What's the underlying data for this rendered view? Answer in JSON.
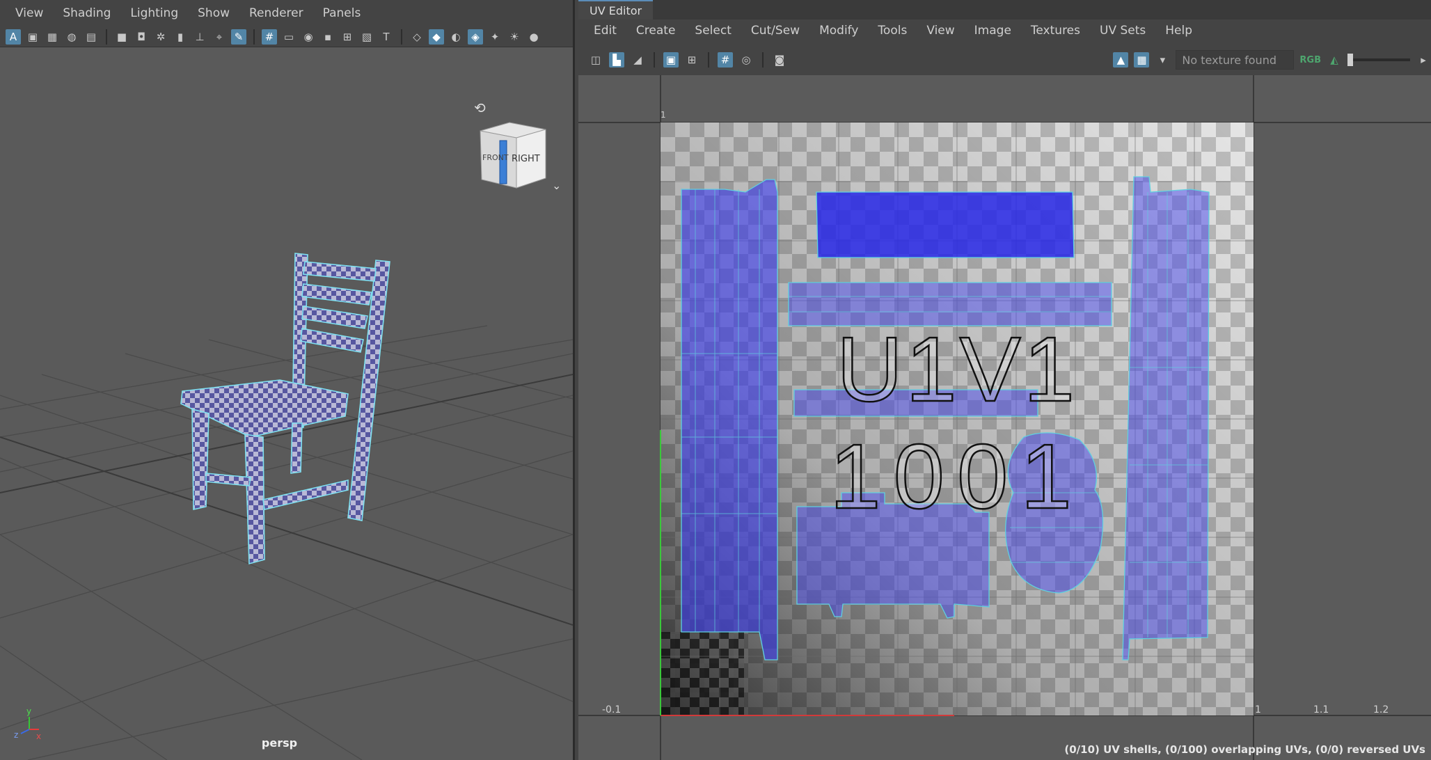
{
  "viewport": {
    "menu": [
      "View",
      "Shading",
      "Lighting",
      "Show",
      "Renderer",
      "Panels"
    ],
    "camera_label": "persp",
    "view_cube": {
      "front_label": "FRONT",
      "right_label": "RIGHT"
    },
    "axis": {
      "x": "x",
      "y": "y",
      "z": "z"
    }
  },
  "uv_editor": {
    "tab_title": "UV Editor",
    "menu": [
      "Edit",
      "Create",
      "Select",
      "Cut/Sew",
      "Modify",
      "Tools",
      "View",
      "Image",
      "Textures",
      "UV Sets",
      "Help"
    ],
    "texture_field": "No texture found",
    "rgb_label": "RGB",
    "tile_label_line1": "U1V1",
    "tile_label_line2": "1001",
    "axis_labels": {
      "neg_u": "-0.1",
      "u1": "1",
      "u11": "1.1",
      "u12": "1.2",
      "v1": "1"
    },
    "status": "(0/10) UV shells, (0/100) overlapping UVs, (0/0) reversed UVs"
  },
  "colors": {
    "accent": "#5285a6",
    "uv_shell_fill": "#3a3af0",
    "uv_wire": "#5fd0e0",
    "background": "#5b5b5b"
  }
}
